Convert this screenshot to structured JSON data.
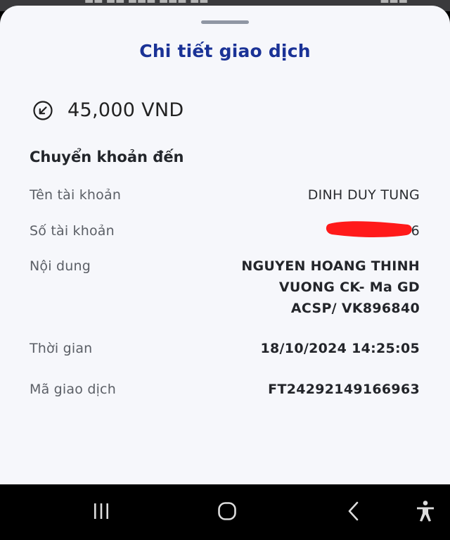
{
  "sheet": {
    "title": "Chi tiết giao dịch",
    "amount": "45,000 VND",
    "amount_icon": "incoming-arrow-circle-icon",
    "section_title": "Chuyển khoản đến",
    "rows": {
      "account_name": {
        "label": "Tên tài khoản",
        "value": "DINH DUY TUNG"
      },
      "account_number": {
        "label": "Số tài khoản",
        "value": "6"
      },
      "content": {
        "label": "Nội dung",
        "lines": [
          "NGUYEN HOANG THINH",
          "VUONG CK- Ma GD",
          "ACSP/ VK896840"
        ]
      },
      "time": {
        "label": "Thời gian",
        "value": "18/10/2024 14:25:05"
      },
      "transaction_id": {
        "label": "Mã giao dịch",
        "value": "FT24292149166963"
      }
    }
  },
  "colors": {
    "title": "#1a3296",
    "redaction": "#ff1a1a",
    "sheet_bg": "#f6f7fb"
  },
  "navbar": {
    "icons": [
      "recent-apps-icon",
      "home-icon",
      "back-icon",
      "accessibility-icon"
    ]
  }
}
